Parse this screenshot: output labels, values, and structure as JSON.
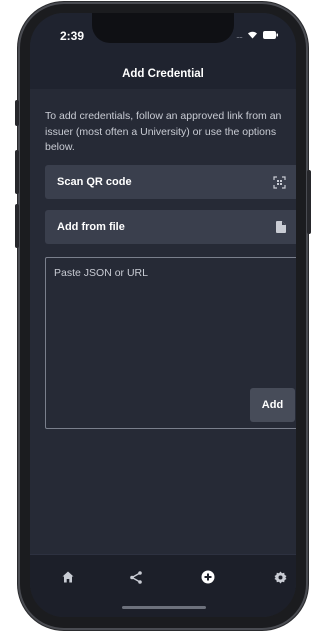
{
  "status_bar": {
    "time": "2:39",
    "signal": "....",
    "icons": [
      "wifi-icon",
      "battery-icon"
    ]
  },
  "header": {
    "title": "Add Credential"
  },
  "instructions": "To add credentials, follow an approved link from an issuer (most often a University) or use the options below.",
  "actions": {
    "scan_qr": {
      "label": "Scan QR code",
      "icon": "qr-scan-icon"
    },
    "add_file": {
      "label": "Add from file",
      "icon": "file-icon"
    }
  },
  "paste": {
    "placeholder": "Paste JSON or URL",
    "add_label": "Add"
  },
  "tabs": [
    {
      "icon": "home-icon"
    },
    {
      "icon": "share-icon"
    },
    {
      "icon": "add-circle-icon",
      "active": true
    },
    {
      "icon": "gear-icon"
    }
  ],
  "colors": {
    "background": "#262a36",
    "header": "#1f232f",
    "button": "#3a3f4d",
    "text": "#c9ccd4"
  }
}
